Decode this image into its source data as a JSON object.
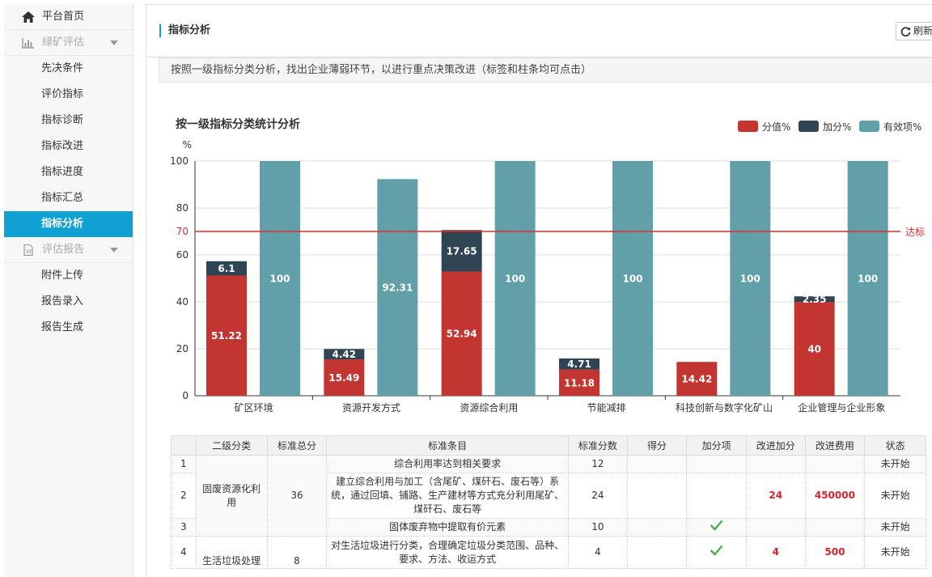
{
  "sidebar": {
    "home": "平台首页",
    "group_green": "绿矿评估",
    "items": [
      "先决条件",
      "评价指标",
      "指标诊断",
      "指标改进",
      "指标进度",
      "指标汇总",
      "指标分析"
    ],
    "group_report": "评估报告",
    "report_items": [
      "附件上传",
      "报告录入",
      "报告生成"
    ]
  },
  "header": {
    "title": "指标分析",
    "refresh": "刷新"
  },
  "hint": "按照一级指标分类分析，找出企业薄弱环节，以进行重点决策改进（标签和柱条均可点击）",
  "chart_data": {
    "type": "bar",
    "title": "按一级指标分类统计分析",
    "ylabel": "%",
    "ylim": [
      0,
      100
    ],
    "yticks": [
      0,
      20,
      40,
      60,
      80,
      100
    ],
    "categories": [
      "矿区环境",
      "资源开发方式",
      "资源综合利用",
      "节能减排",
      "科技创新与数字化矿山",
      "企业管理与企业形象"
    ],
    "series": [
      {
        "name": "分值%",
        "color": "#c23531",
        "stack": "s",
        "values": [
          51.22,
          15.49,
          52.94,
          11.18,
          14.42,
          40
        ]
      },
      {
        "name": "加分%",
        "color": "#2f4554",
        "stack": "s",
        "values": [
          6.1,
          4.42,
          17.65,
          4.71,
          0,
          2.35
        ]
      },
      {
        "name": "有效项%",
        "color": "#61a0a8",
        "stack": "v",
        "values": [
          100,
          92.31,
          100,
          100,
          100,
          100
        ]
      }
    ],
    "threshold": {
      "value": 70,
      "label": "达标",
      "color": "#e52a2a"
    },
    "legend_position": "top-right",
    "grid": true
  },
  "table": {
    "headers": [
      "",
      "二级分类",
      "标准总分",
      "标准条目",
      "标准分数",
      "得分",
      "加分项",
      "改进加分",
      "改进费用",
      "状态"
    ],
    "rows": [
      {
        "no": "1",
        "item": "综合利用率达到相关要求",
        "std": "12",
        "score": "",
        "bonus": false,
        "imp": "",
        "cost": "",
        "status": "未开始"
      },
      {
        "no": "2",
        "item": "建立综合利用与加工（含尾矿、煤矸石、废石等）系统，通过回填、铺路、生产建材等方式充分利用尾矿、煤矸石、废石等",
        "std": "24",
        "score": "",
        "bonus": false,
        "imp": "24",
        "cost": "450000",
        "status": "未开始"
      },
      {
        "no": "3",
        "item": "固体废弃物中提取有价元素",
        "std": "10",
        "score": "",
        "bonus": true,
        "imp": "",
        "cost": "",
        "status": "未开始"
      },
      {
        "no": "4",
        "item": "对生活垃圾进行分类，合理确定垃圾分类范围、品种、要求、方法、收运方式",
        "std": "4",
        "score": "",
        "bonus": true,
        "imp": "4",
        "cost": "500",
        "status": "未开始"
      }
    ],
    "groups": [
      {
        "name": "固废资源化利用",
        "total": "36"
      },
      {
        "name": "生活垃圾处理",
        "total": "8"
      }
    ]
  }
}
